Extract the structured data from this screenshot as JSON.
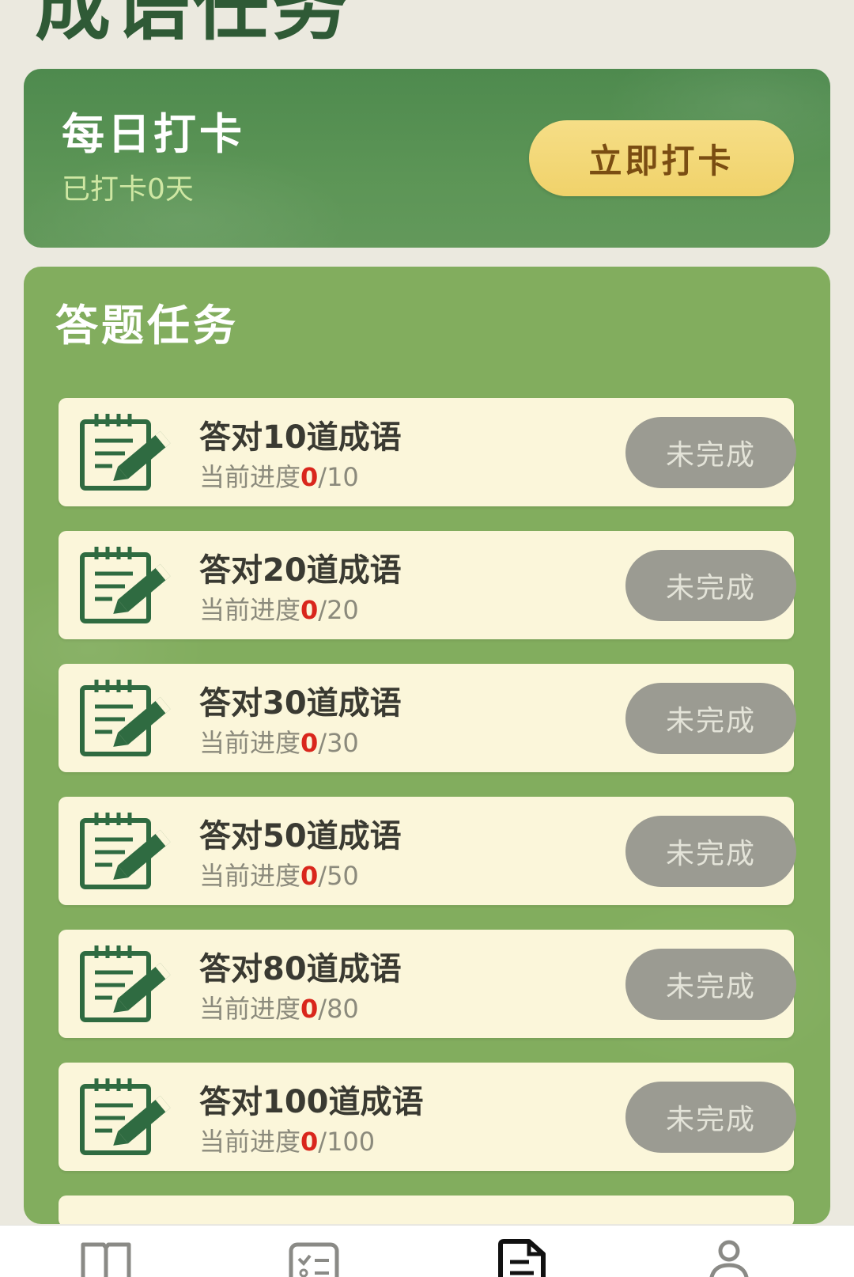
{
  "page": {
    "title": "成语任务"
  },
  "checkin": {
    "title": "每日打卡",
    "status": "已打卡0天",
    "button_label": "立即打卡"
  },
  "quiz_tasks": {
    "title": "答题任务",
    "status_label": "未完成",
    "progress_prefix": "当前进度",
    "items": [
      {
        "title": "答对10道成语",
        "current": "0",
        "total": "/10",
        "status": "未完成"
      },
      {
        "title": "答对20道成语",
        "current": "0",
        "total": "/20",
        "status": "未完成"
      },
      {
        "title": "答对30道成语",
        "current": "0",
        "total": "/30",
        "status": "未完成"
      },
      {
        "title": "答对50道成语",
        "current": "0",
        "total": "/50",
        "status": "未完成"
      },
      {
        "title": "答对80道成语",
        "current": "0",
        "total": "/80",
        "status": "未完成"
      },
      {
        "title": "答对100道成语",
        "current": "0",
        "total": "/100",
        "status": "未完成"
      }
    ]
  },
  "tabbar": {
    "tabs": [
      {
        "icon": "book-icon",
        "active": false
      },
      {
        "icon": "checklist-icon",
        "active": false
      },
      {
        "icon": "document-icon",
        "active": true
      },
      {
        "icon": "user-icon",
        "active": false
      }
    ]
  },
  "colors": {
    "page_bg": "#ebe9df",
    "title_green": "#2f5a36",
    "checkin_card": "#5c9556",
    "checkin_button": "#f0d26a",
    "panel_green": "#82ad5e",
    "item_bg": "#fbf6da",
    "status_button": "#9b9b92",
    "progress_current": "#d9261c"
  }
}
